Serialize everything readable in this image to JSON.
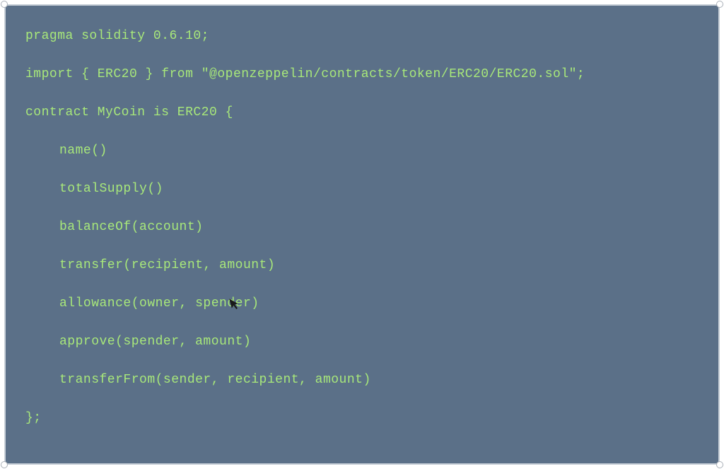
{
  "code": {
    "line1": {
      "kw_pragma": "pragma",
      "kw_solidity": "solidity",
      "version": "0.6.10",
      "semi": ";"
    },
    "line2": {
      "kw_import": "import",
      "brace_open": "{",
      "symbol": "ERC20",
      "brace_close": "}",
      "kw_from": "from",
      "path": "\"@openzeppelin/contracts/token/ERC20/ERC20.sol\"",
      "semi": ";"
    },
    "line3": {
      "kw_contract": "contract",
      "name": "MyCoin",
      "kw_is": "is",
      "base": "ERC20",
      "brace": "{"
    },
    "fn1": "name()",
    "fn2": "totalSupply()",
    "fn3": "balanceOf(account)",
    "fn4": "transfer(recipient, amount)",
    "fn5": "allowance(owner, spender)",
    "fn6": "approve(spender, amount)",
    "fn7": "transferFrom(sender, recipient, amount)",
    "close": "};"
  }
}
